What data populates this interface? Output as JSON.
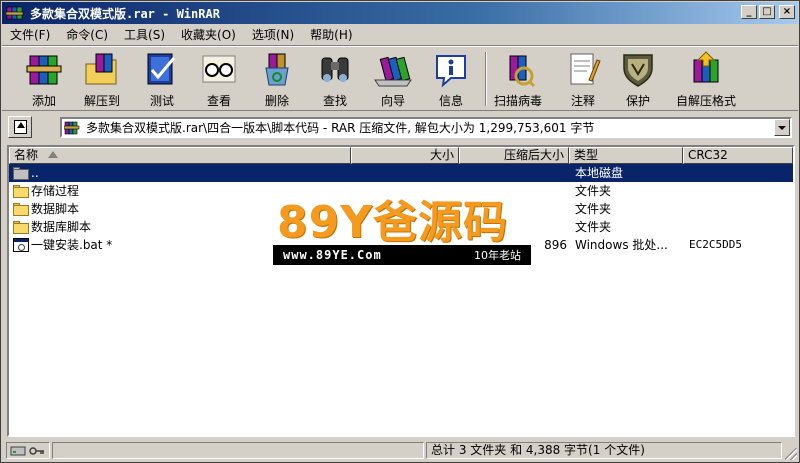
{
  "window": {
    "title": "多款集合双模式版.rar - WinRAR",
    "controls": {
      "minimize": "_",
      "maximize": "□",
      "close": "×"
    }
  },
  "menu": [
    "文件(F)",
    "命令(C)",
    "工具(S)",
    "收藏夹(O)",
    "选项(N)",
    "帮助(H)"
  ],
  "toolbar": [
    {
      "label": "添加",
      "icon": "add-books-icon"
    },
    {
      "label": "解压到",
      "icon": "extract-folder-icon"
    },
    {
      "label": "测试",
      "icon": "test-check-icon"
    },
    {
      "label": "查看",
      "icon": "view-glasses-icon"
    },
    {
      "label": "删除",
      "icon": "delete-recycle-icon"
    },
    {
      "label": "查找",
      "icon": "find-binoculars-icon"
    },
    {
      "label": "向导",
      "icon": "wizard-icon"
    },
    {
      "label": "信息",
      "icon": "info-icon"
    },
    {
      "label": "扫描病毒",
      "icon": "virus-scan-icon"
    },
    {
      "label": "注释",
      "icon": "comment-icon"
    },
    {
      "label": "保护",
      "icon": "protect-shield-icon"
    },
    {
      "label": "自解压格式",
      "icon": "sfx-icon"
    }
  ],
  "address": {
    "path": "多款集合双模式版.rar\\四合一版本\\脚本代码 - RAR 压缩文件, 解包大小为 1,299,753,601 字节"
  },
  "columns": {
    "name": "名称",
    "size": "大小",
    "packed": "压缩后大小",
    "type": "类型",
    "crc": "CRC32"
  },
  "rows": [
    {
      "name": "..",
      "size": "",
      "packed": "",
      "type": "本地磁盘",
      "crc": "",
      "kind": "up",
      "selected": true
    },
    {
      "name": "存储过程",
      "size": "",
      "packed": "",
      "type": "文件夹",
      "crc": "",
      "kind": "folder",
      "selected": false
    },
    {
      "name": "数据脚本",
      "size": "",
      "packed": "",
      "type": "文件夹",
      "crc": "",
      "kind": "folder",
      "selected": false
    },
    {
      "name": "数据库脚本",
      "size": "",
      "packed": "",
      "type": "文件夹",
      "crc": "",
      "kind": "folder",
      "selected": false
    },
    {
      "name": "一键安装.bat *",
      "size": "",
      "packed": "896",
      "type": "Windows 批处...",
      "crc": "EC2C5DD5",
      "kind": "bat",
      "selected": false
    }
  ],
  "watermark": {
    "logo": "89Y爸源码",
    "url": "www.89YE.Com",
    "slogan": "10年老站"
  },
  "status": {
    "summary": "总计 3 文件夹 和 4,388 字节(1 个文件)"
  },
  "colors": {
    "titlebar_start": "#0a246a",
    "titlebar_end": "#a6caf0",
    "selection": "#0a246a",
    "watermark_orange": "#f39a1f"
  }
}
